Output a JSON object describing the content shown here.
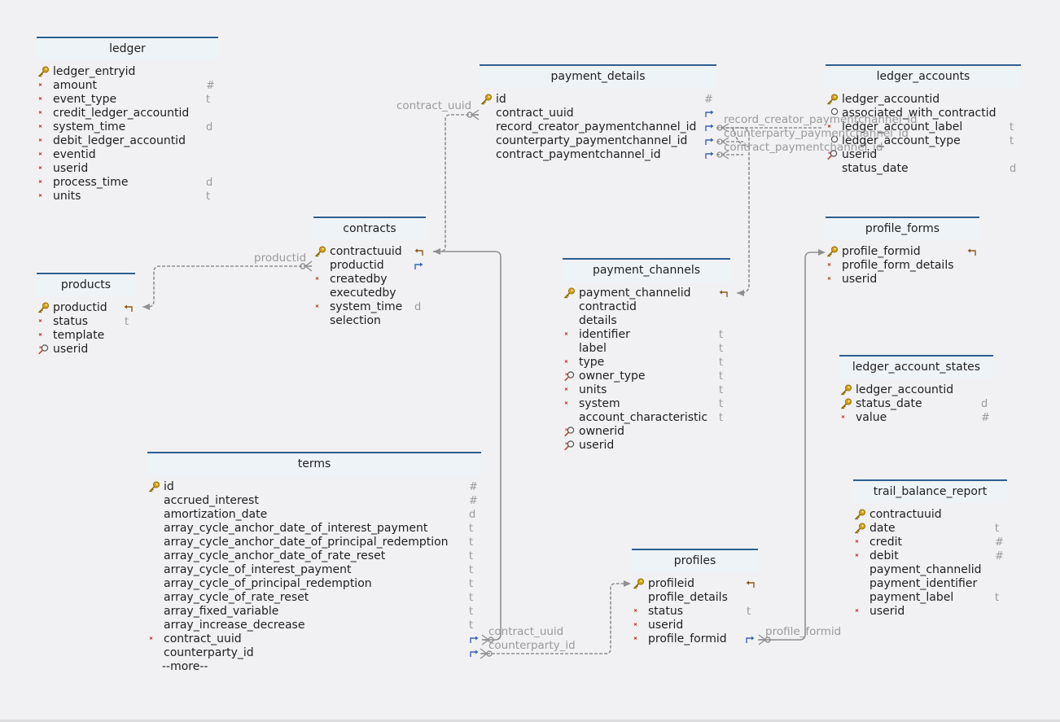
{
  "tables": [
    {
      "id": "ledger",
      "title": "ledger",
      "columns": [
        {
          "name": "ledger_entryid",
          "icon": "pk",
          "type": ""
        },
        {
          "name": "amount",
          "icon": "req",
          "type": "#"
        },
        {
          "name": "event_type",
          "icon": "req",
          "type": "t"
        },
        {
          "name": "credit_ledger_accountid",
          "icon": "req",
          "type": ""
        },
        {
          "name": "system_time",
          "icon": "req",
          "type": "d"
        },
        {
          "name": "debit_ledger_accountid",
          "icon": "req",
          "type": ""
        },
        {
          "name": "eventid",
          "icon": "req",
          "type": ""
        },
        {
          "name": "userid",
          "icon": "req",
          "type": ""
        },
        {
          "name": "process_time",
          "icon": "req",
          "type": "d"
        },
        {
          "name": "units",
          "icon": "req",
          "type": "t"
        }
      ]
    },
    {
      "id": "products",
      "title": "products",
      "columns": [
        {
          "name": "productid",
          "icon": "pk",
          "type": "",
          "fk": "ref"
        },
        {
          "name": "status",
          "icon": "req",
          "type": "t"
        },
        {
          "name": "template",
          "icon": "req",
          "type": ""
        },
        {
          "name": "userid",
          "icon": "idx",
          "type": ""
        }
      ]
    },
    {
      "id": "contracts",
      "title": "contracts",
      "columns": [
        {
          "name": "contractuuid",
          "icon": "pk",
          "type": "",
          "fk": "ref"
        },
        {
          "name": "productid",
          "icon": "",
          "type": "",
          "fk": "out"
        },
        {
          "name": "createdby",
          "icon": "req",
          "type": ""
        },
        {
          "name": "executedby",
          "icon": "",
          "type": ""
        },
        {
          "name": "system_time",
          "icon": "req",
          "type": "d"
        },
        {
          "name": "selection",
          "icon": "",
          "type": ""
        }
      ]
    },
    {
      "id": "payment_details",
      "title": "payment_details",
      "columns": [
        {
          "name": "id",
          "icon": "pk",
          "type": "#"
        },
        {
          "name": "contract_uuid",
          "icon": "",
          "type": "",
          "fk": "out"
        },
        {
          "name": "record_creator_paymentchannel_id",
          "icon": "",
          "type": "",
          "fk": "out"
        },
        {
          "name": "counterparty_paymentchannel_id",
          "icon": "",
          "type": "",
          "fk": "out"
        },
        {
          "name": "contract_paymentchannel_id",
          "icon": "",
          "type": "",
          "fk": "out"
        }
      ]
    },
    {
      "id": "ledger_accounts",
      "title": "ledger_accounts",
      "columns": [
        {
          "name": "ledger_accountid",
          "icon": "pk",
          "type": ""
        },
        {
          "name": "associated_with_contractid",
          "icon": "opt",
          "type": ""
        },
        {
          "name": "ledger_account_label",
          "icon": "req",
          "type": "t"
        },
        {
          "name": "ledger_account_type",
          "icon": "opt",
          "type": "t"
        },
        {
          "name": "userid",
          "icon": "idx",
          "type": ""
        },
        {
          "name": "status_date",
          "icon": "",
          "type": "d"
        }
      ]
    },
    {
      "id": "payment_channels",
      "title": "payment_channels",
      "columns": [
        {
          "name": "payment_channelid",
          "icon": "pk",
          "type": "",
          "fk": "ref"
        },
        {
          "name": "contractid",
          "icon": "",
          "type": ""
        },
        {
          "name": "details",
          "icon": "",
          "type": ""
        },
        {
          "name": "identifier",
          "icon": "req",
          "type": "t"
        },
        {
          "name": "label",
          "icon": "",
          "type": "t"
        },
        {
          "name": "type",
          "icon": "req",
          "type": "t"
        },
        {
          "name": "owner_type",
          "icon": "idx",
          "type": "t"
        },
        {
          "name": "units",
          "icon": "req",
          "type": "t"
        },
        {
          "name": "system",
          "icon": "req",
          "type": "t"
        },
        {
          "name": "account_characteristic",
          "icon": "",
          "type": "t"
        },
        {
          "name": "ownerid",
          "icon": "idx",
          "type": ""
        },
        {
          "name": "userid",
          "icon": "idx",
          "type": ""
        }
      ]
    },
    {
      "id": "profile_forms",
      "title": "profile_forms",
      "columns": [
        {
          "name": "profile_formid",
          "icon": "pk",
          "type": "",
          "fk": "ref"
        },
        {
          "name": "profile_form_details",
          "icon": "req",
          "type": ""
        },
        {
          "name": "userid",
          "icon": "req",
          "type": ""
        }
      ]
    },
    {
      "id": "ledger_account_states",
      "title": "ledger_account_states",
      "columns": [
        {
          "name": "ledger_accountid",
          "icon": "pk",
          "type": ""
        },
        {
          "name": "status_date",
          "icon": "pk",
          "type": "d"
        },
        {
          "name": "value",
          "icon": "req",
          "type": "#"
        }
      ]
    },
    {
      "id": "trail_balance_report",
      "title": "trail_balance_report",
      "columns": [
        {
          "name": "contractuuid",
          "icon": "pk",
          "type": ""
        },
        {
          "name": "date",
          "icon": "pk",
          "type": "t"
        },
        {
          "name": "credit",
          "icon": "req",
          "type": "#"
        },
        {
          "name": "debit",
          "icon": "req",
          "type": "#"
        },
        {
          "name": "payment_channelid",
          "icon": "",
          "type": ""
        },
        {
          "name": "payment_identifier",
          "icon": "",
          "type": ""
        },
        {
          "name": "payment_label",
          "icon": "",
          "type": "t"
        },
        {
          "name": "userid",
          "icon": "req",
          "type": ""
        }
      ]
    },
    {
      "id": "terms",
      "title": "terms",
      "columns": [
        {
          "name": "id",
          "icon": "pk",
          "type": "#"
        },
        {
          "name": "accrued_interest",
          "icon": "",
          "type": "#"
        },
        {
          "name": "amortization_date",
          "icon": "",
          "type": "d"
        },
        {
          "name": "array_cycle_anchor_date_of_interest_payment",
          "icon": "",
          "type": "t"
        },
        {
          "name": "array_cycle_anchor_date_of_principal_redemption",
          "icon": "",
          "type": "t"
        },
        {
          "name": "array_cycle_anchor_date_of_rate_reset",
          "icon": "",
          "type": "t"
        },
        {
          "name": "array_cycle_of_interest_payment",
          "icon": "",
          "type": "t"
        },
        {
          "name": "array_cycle_of_principal_redemption",
          "icon": "",
          "type": "t"
        },
        {
          "name": "array_cycle_of_rate_reset",
          "icon": "",
          "type": "t"
        },
        {
          "name": "array_fixed_variable",
          "icon": "",
          "type": "t"
        },
        {
          "name": "array_increase_decrease",
          "icon": "",
          "type": "t"
        },
        {
          "name": "contract_uuid",
          "icon": "req",
          "type": "",
          "fk": "out"
        },
        {
          "name": "counterparty_id",
          "icon": "",
          "type": "",
          "fk": "out"
        }
      ],
      "more": "--more--"
    },
    {
      "id": "profiles",
      "title": "profiles",
      "columns": [
        {
          "name": "profileid",
          "icon": "pk",
          "type": "",
          "fk": "ref"
        },
        {
          "name": "profile_details",
          "icon": "",
          "type": ""
        },
        {
          "name": "status",
          "icon": "req",
          "type": "t"
        },
        {
          "name": "userid",
          "icon": "req",
          "type": ""
        },
        {
          "name": "profile_formid",
          "icon": "req",
          "type": "",
          "fk": "out"
        }
      ]
    }
  ],
  "relationship_labels": {
    "contract_uuid_pd": "contract_uuid",
    "productid": "productid",
    "record_creator": "record_creator_paymentchannel_id",
    "counterparty": "counterparty_paymentchannel_id",
    "contract_pc": "contract_paymentchannel_id",
    "terms_contract_uuid": "contract_uuid",
    "terms_counterparty_id": "counterparty_id",
    "profile_formid": "profile_formid"
  },
  "colors": {
    "header_border": "#2f5f8f",
    "header_bg": "#eef3f8",
    "pk_key": "#d4a017",
    "required": "#c0392b",
    "link": "#909090",
    "fk_arrow": "#3b63b5",
    "ref_arrow": "#8a5a1b"
  }
}
